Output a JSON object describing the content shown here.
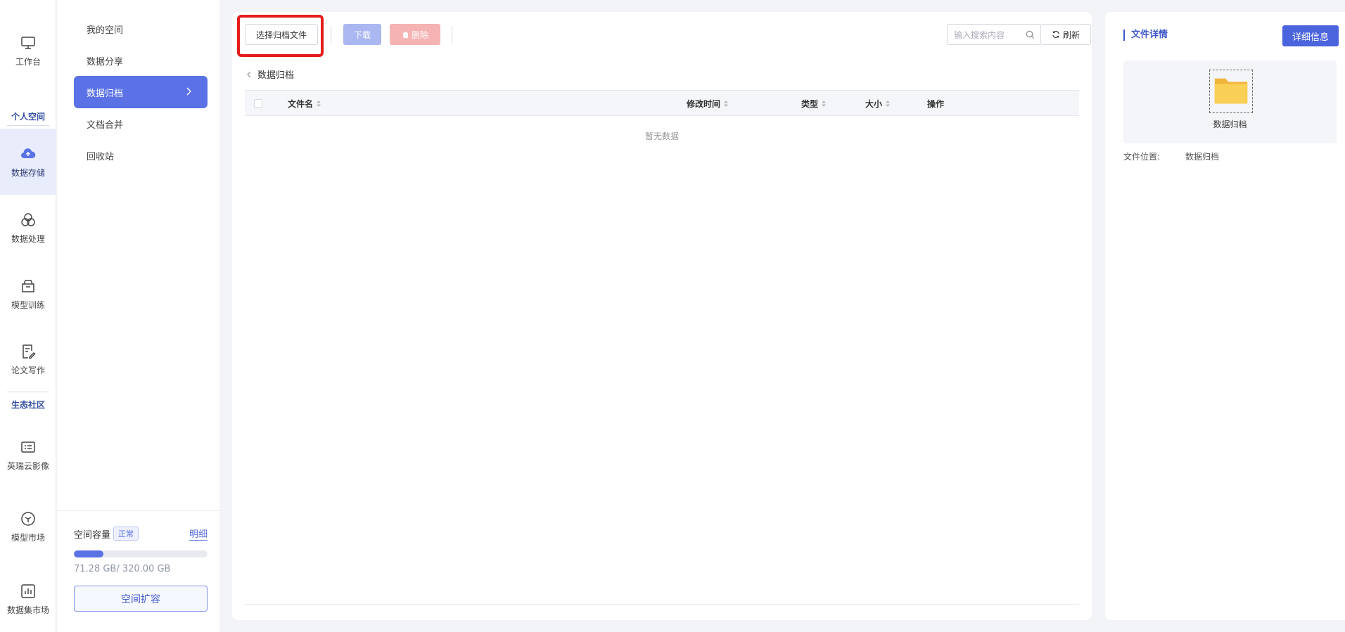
{
  "rail": {
    "workbench": "工作台",
    "section_personal": "个人空间",
    "data_storage": "数据存储",
    "data_processing": "数据处理",
    "model_training": "模型训练",
    "paper_writing": "论文写作",
    "section_ecosystem": "生态社区",
    "yingrui_cloud_image": "英瑞云影像",
    "model_market": "模型市场",
    "dataset_market": "数据集市场"
  },
  "subnav": {
    "items": [
      {
        "label": "我的空间"
      },
      {
        "label": "数据分享"
      },
      {
        "label": "数据归档"
      },
      {
        "label": "文档合并"
      },
      {
        "label": "回收站"
      }
    ],
    "active_index": 2,
    "capacity_label": "空间容量",
    "capacity_status": "正常",
    "capacity_detail": "明细",
    "capacity_used_fraction": 0.2228,
    "capacity_text": "71.28 GB/ 320.00 GB",
    "expand_button": "空间扩容"
  },
  "toolbar": {
    "select_archive_file": "选择归档文件",
    "download": "下载",
    "delete": "删除",
    "search_placeholder": "输入搜索内容",
    "refresh": "刷新"
  },
  "breadcrumb": {
    "current": "数据归档"
  },
  "table": {
    "columns": [
      "文件名",
      "修改时间",
      "类型",
      "大小",
      "操作"
    ],
    "empty_text": "暂无数据"
  },
  "detail": {
    "title": "文件详情",
    "info_button": "详细信息",
    "folder_name": "数据归档",
    "location_label": "文件位置:",
    "location_value": "数据归档"
  },
  "colors": {
    "primary": "#5a72e6",
    "highlight": "#e51c1c",
    "folder": "#f7c646"
  }
}
